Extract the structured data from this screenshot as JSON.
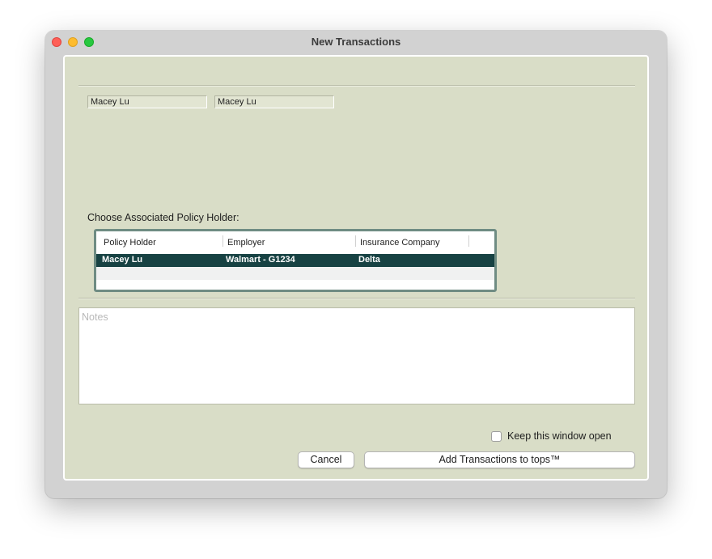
{
  "window": {
    "title": "New Transactions"
  },
  "fields": {
    "first_value": "Macey Lu",
    "second_value": "Macey Lu"
  },
  "policy_section": {
    "label": "Choose Associated Policy Holder:",
    "columns": [
      "Policy Holder",
      "Employer",
      "Insurance Company"
    ],
    "rows": [
      {
        "policy_holder": "Macey Lu",
        "employer": "Walmart - G1234",
        "insurance_company": "Delta",
        "selected": true
      }
    ]
  },
  "notes": {
    "placeholder": "Notes",
    "value": ""
  },
  "keep_open": {
    "label": "Keep this window open",
    "checked": false
  },
  "buttons": {
    "cancel": "Cancel",
    "add": "Add Transactions to tops™"
  },
  "colors": {
    "content_bg": "#d9ddc7",
    "selected_row": "#174243",
    "table_border": "#6f8c83"
  }
}
